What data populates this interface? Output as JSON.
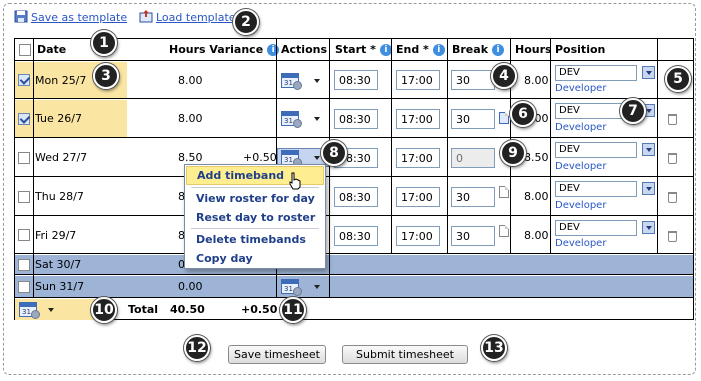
{
  "toolbar": {
    "save_template": "Save as template",
    "load_template": "Load template"
  },
  "columns": {
    "date": "Date",
    "hours_variance": "Hours Variance",
    "actions": "Actions",
    "start": "Start *",
    "end": "End *",
    "break": "Break",
    "hours": "Hours",
    "position": "Position"
  },
  "rows": [
    {
      "date": "Mon 25/7",
      "hours": "8.00",
      "variance": "",
      "start": "08:30",
      "end": "17:00",
      "brk": "30",
      "total": "8.00",
      "pos": "DEV",
      "pos_desc": "Developer",
      "checked": true
    },
    {
      "date": "Tue 26/7",
      "hours": "8.00",
      "variance": "",
      "start": "08:30",
      "end": "17:00",
      "brk": "30",
      "total": "8.00",
      "pos": "DEV",
      "pos_desc": "Developer",
      "checked": true
    },
    {
      "date": "Wed 27/7",
      "hours": "8.50",
      "variance": "+0.50",
      "start": "08:30",
      "end": "17:00",
      "brk": "0",
      "total": "8.50",
      "pos": "DEV",
      "pos_desc": "Developer",
      "checked": false
    },
    {
      "date": "Thu 28/7",
      "hours": "8",
      "variance": "",
      "start": "08:30",
      "end": "17:00",
      "brk": "30",
      "total": "8.00",
      "pos": "DEV",
      "pos_desc": "Developer",
      "checked": false
    },
    {
      "date": "Fri 29/7",
      "hours": "8",
      "variance": "",
      "start": "08:30",
      "end": "17:00",
      "brk": "30",
      "total": "8.00",
      "pos": "DEV",
      "pos_desc": "Developer",
      "checked": false
    },
    {
      "date": "Sat 30/7",
      "hours": "0",
      "checked": false
    },
    {
      "date": "Sun 31/7",
      "hours": "0.00",
      "checked": false
    }
  ],
  "cal_icon_text": "31",
  "footer": {
    "total_label": "Total",
    "total_hours": "40.50",
    "total_variance": "+0.50"
  },
  "menu": {
    "items": [
      "Add timeband",
      "View roster for day",
      "Reset day to roster",
      "Delete timebands",
      "Copy day"
    ]
  },
  "buttons": {
    "save": "Save timesheet",
    "submit": "Submit timesheet"
  },
  "badges": [
    "1",
    "2",
    "3",
    "4",
    "5",
    "6",
    "7",
    "8",
    "9",
    "10",
    "11",
    "12",
    "13"
  ],
  "colors": {
    "weekday_highlight": "#fbe5a3",
    "weekend_fill": "#9db4d6",
    "link": "#2a56c6",
    "badge": "#222222"
  }
}
